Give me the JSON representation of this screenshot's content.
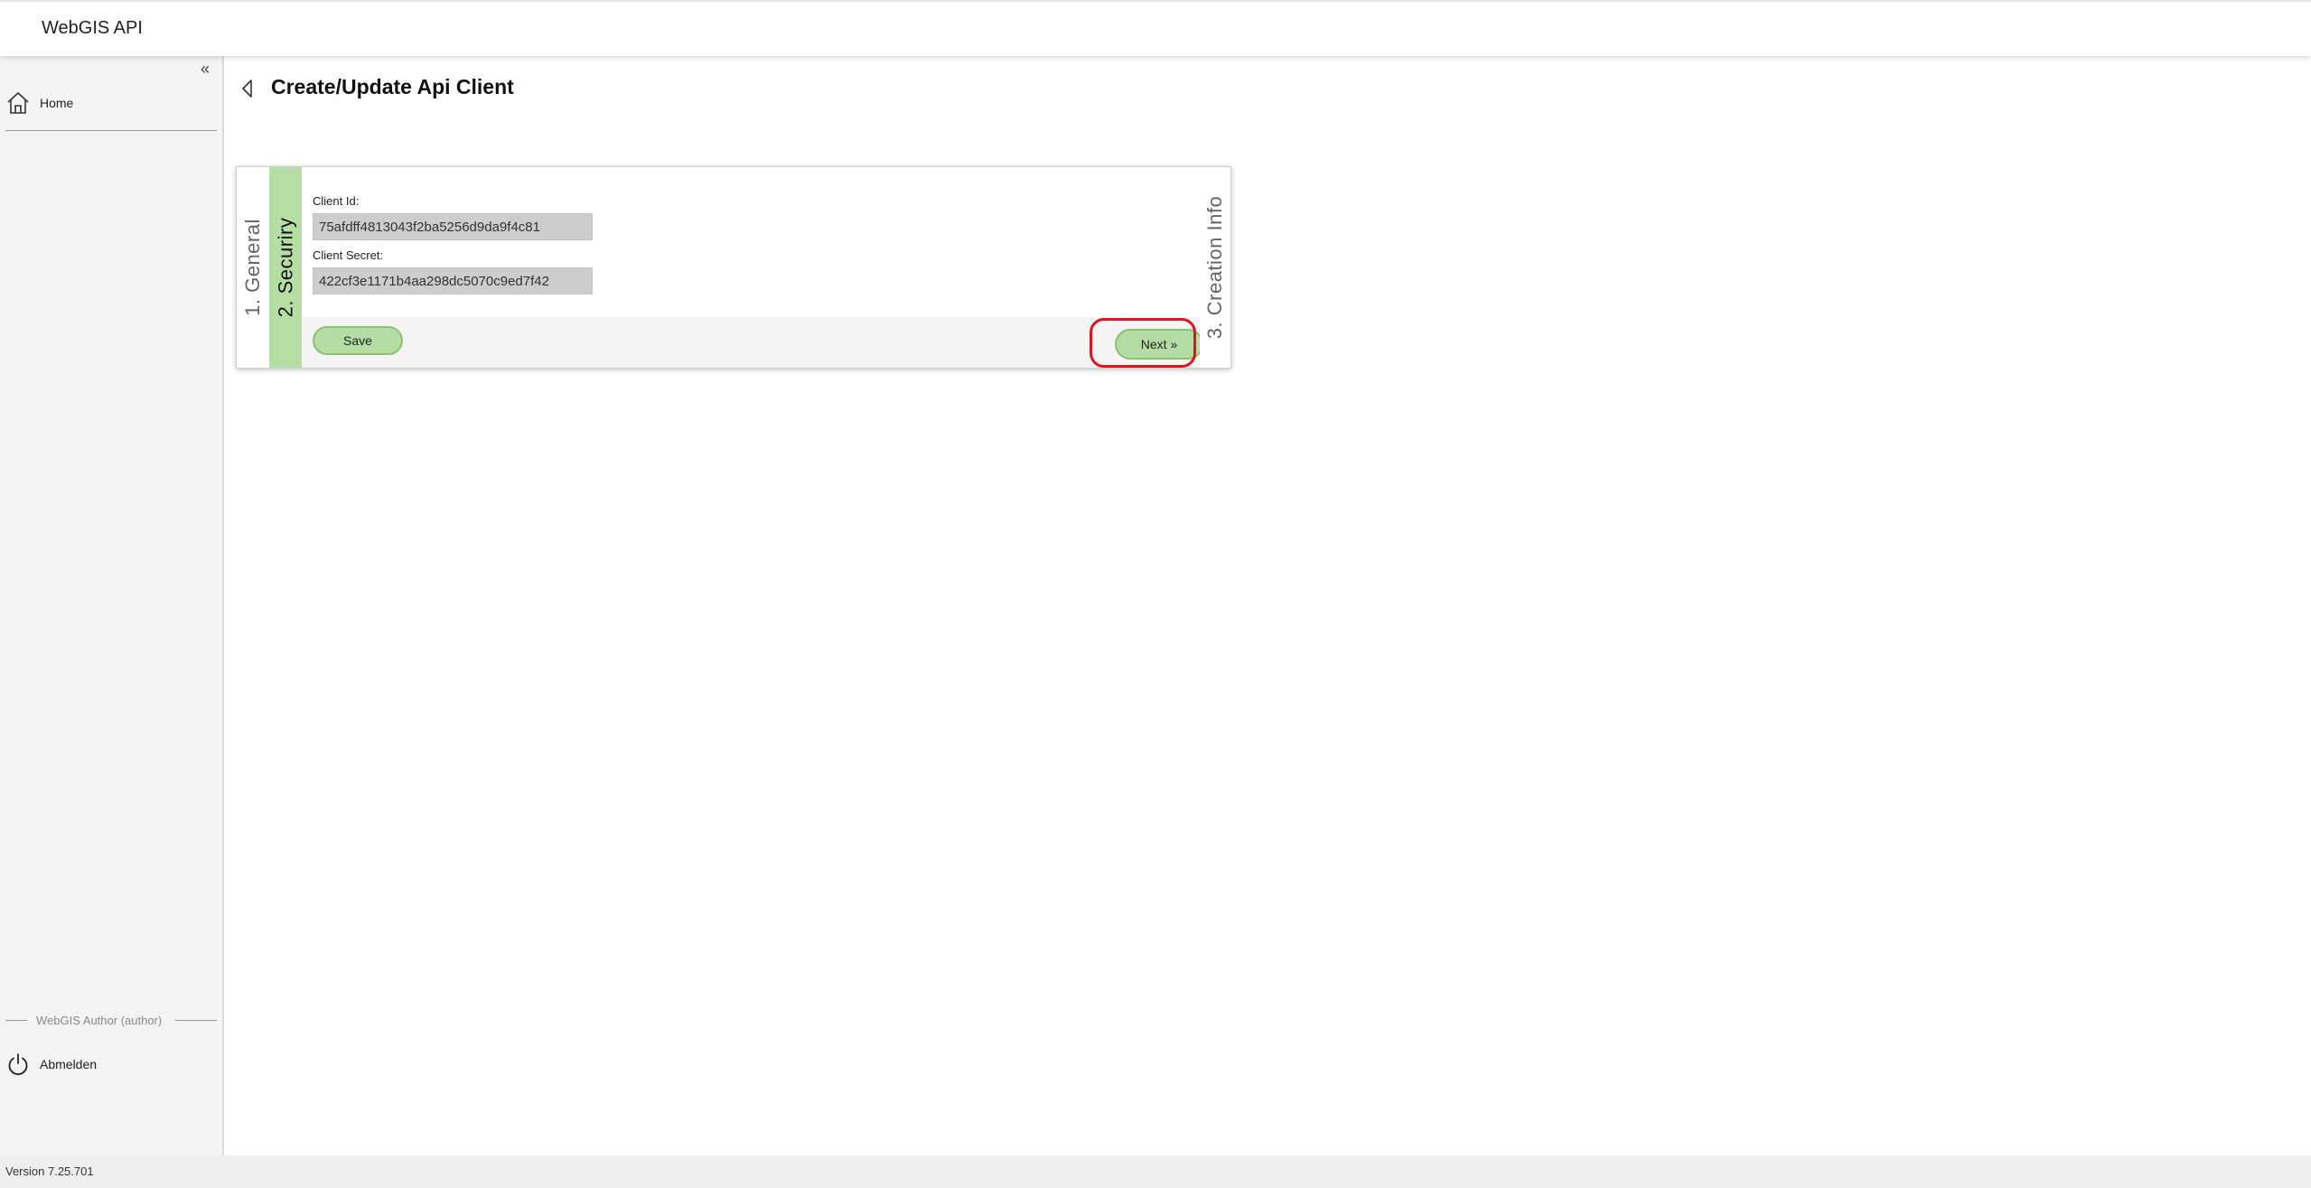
{
  "app": {
    "title": "WebGIS API",
    "version": "Version 7.25.701"
  },
  "sidebar": {
    "collapse_glyph": "«",
    "items": [
      {
        "label": "Home",
        "icon": "home-icon"
      }
    ],
    "user_label": "WebGIS Author (author)",
    "logout_label": "Abmelden",
    "logout_icon": "power-icon"
  },
  "page": {
    "title": "Create/Update Api Client",
    "back_icon": "chevron-left-icon"
  },
  "wizard": {
    "tabs": [
      {
        "label": "1.  General",
        "active": false
      },
      {
        "label": "2.  Securiry",
        "active": true
      },
      {
        "label": "3.  Creation Info",
        "active": false
      }
    ],
    "fields": {
      "client_id_label": "Client Id:",
      "client_id_value": "75afdff4813043f2ba5256d9da9f4c81",
      "client_secret_label": "Client Secret:",
      "client_secret_value": "422cf3e1171b4aa298dc5070c9ed7f42"
    },
    "buttons": {
      "save_label": "Save",
      "next_label": "Next »"
    }
  },
  "colors": {
    "accent_green": "#b6dda4",
    "button_border": "#8cc26f",
    "highlight_red": "#e0141e",
    "sidebar_bg": "#f3f3f3"
  }
}
